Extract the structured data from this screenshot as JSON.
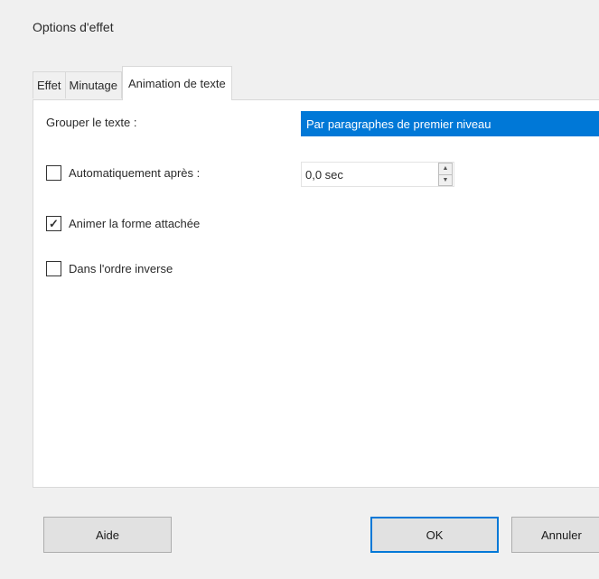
{
  "dialog": {
    "title": "Options d'effet"
  },
  "tabs": [
    {
      "label": "Effet",
      "active": false
    },
    {
      "label": "Minutage",
      "active": false
    },
    {
      "label": "Animation de texte",
      "active": true
    }
  ],
  "panel": {
    "group_label": "Grouper le texte :",
    "group_value": "Par paragraphes de premier niveau",
    "auto_label": "Automatiquement après :",
    "auto_checked": false,
    "auto_value": "0,0 sec",
    "animate_shape_label": "Animer la forme attachée",
    "animate_shape_checked": true,
    "reverse_label": "Dans l'ordre inverse",
    "reverse_checked": false
  },
  "buttons": {
    "help": "Aide",
    "ok": "OK",
    "cancel": "Annuler"
  },
  "colors": {
    "accent": "#0078d7",
    "background": "#f0f0f0"
  }
}
